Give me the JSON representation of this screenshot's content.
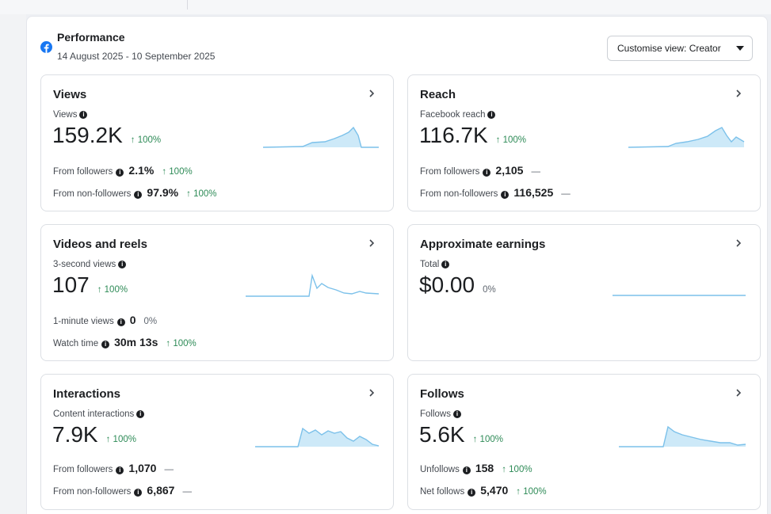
{
  "header": {
    "title": "Performance",
    "date_range": "14 August 2025 - 10 September 2025",
    "customise_label": "Customise view: Creator"
  },
  "cards": [
    {
      "title": "Views",
      "sublabel": "Views",
      "value": "159.2K",
      "delta": "↑ 100%",
      "rows": [
        {
          "label": "From followers",
          "value": "2.1%",
          "delta": "↑ 100%"
        },
        {
          "label": "From non-followers",
          "value": "97.9%",
          "delta": "↑ 100%"
        }
      ]
    },
    {
      "title": "Reach",
      "sublabel": "Facebook reach",
      "value": "116.7K",
      "delta": "↑ 100%",
      "rows": [
        {
          "label": "From followers",
          "value": "2,105",
          "delta": "—"
        },
        {
          "label": "From non-followers",
          "value": "116,525",
          "delta": "—"
        }
      ]
    },
    {
      "title": "Videos and reels",
      "sublabel": "3-second views",
      "value": "107",
      "delta": "↑ 100%",
      "rows": [
        {
          "label": "1-minute views",
          "value": "0",
          "delta": "0%"
        },
        {
          "label": "Watch time",
          "value": "30m 13s",
          "delta": "↑ 100%"
        }
      ]
    },
    {
      "title": "Approximate earnings",
      "sublabel": "Total",
      "value": "$0.00",
      "delta": "0%",
      "rows": []
    },
    {
      "title": "Interactions",
      "sublabel": "Content interactions",
      "value": "7.9K",
      "delta": "↑ 100%",
      "rows": [
        {
          "label": "From followers",
          "value": "1,070",
          "delta": "—"
        },
        {
          "label": "From non-followers",
          "value": "6,867",
          "delta": "—"
        }
      ]
    },
    {
      "title": "Follows",
      "sublabel": "Follows",
      "value": "5.6K",
      "delta": "↑ 100%",
      "rows": [
        {
          "label": "Unfollows",
          "value": "158",
          "delta": "↑ 100%"
        },
        {
          "label": "Net follows",
          "value": "5,470",
          "delta": "↑ 100%"
        }
      ]
    }
  ],
  "colors": {
    "accent": "#1877f2",
    "positive": "#2e8b57",
    "spark_line": "#7cc1ea",
    "spark_fill": "#cde9f8"
  }
}
